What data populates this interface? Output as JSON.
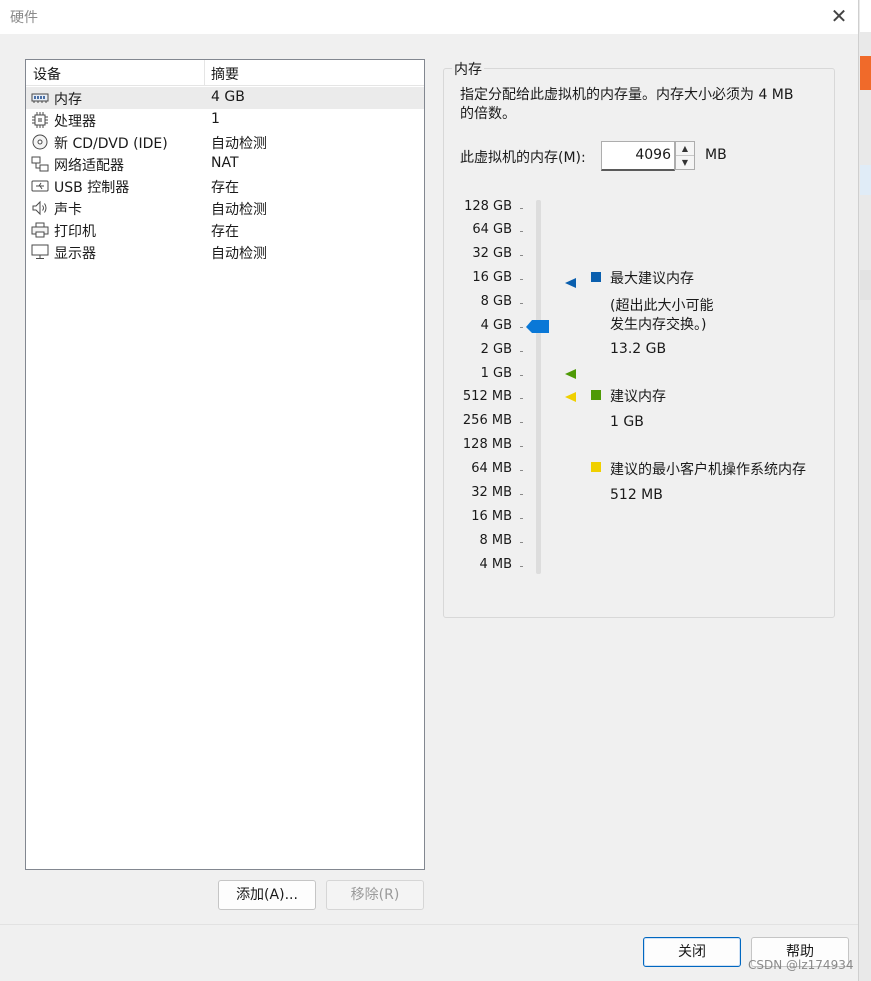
{
  "window": {
    "title": "硬件",
    "close_glyph": "✕"
  },
  "device_list": {
    "columns": [
      "设备",
      "摘要"
    ],
    "rows": [
      {
        "icon": "memory-icon",
        "name": "内存",
        "summary": "4 GB",
        "selected": true
      },
      {
        "icon": "processor-icon",
        "name": "处理器",
        "summary": "1"
      },
      {
        "icon": "cd-dvd-icon",
        "name": "新 CD/DVD (IDE)",
        "summary": "自动检测"
      },
      {
        "icon": "network-adapter-icon",
        "name": "网络适配器",
        "summary": "NAT"
      },
      {
        "icon": "usb-icon",
        "name": "USB 控制器",
        "summary": "存在"
      },
      {
        "icon": "sound-card-icon",
        "name": "声卡",
        "summary": "自动检测"
      },
      {
        "icon": "printer-icon",
        "name": "打印机",
        "summary": "存在"
      },
      {
        "icon": "display-icon",
        "name": "显示器",
        "summary": "自动检测"
      }
    ]
  },
  "buttons": {
    "add": "添加(A)...",
    "remove": "移除(R)",
    "close": "关闭",
    "help": "帮助"
  },
  "memory": {
    "group_title": "内存",
    "description_line1": "指定分配给此虚拟机的内存量。内存大小必须为 4 MB",
    "description_line2": "的倍数。",
    "input_label": "此虚拟机的内存(M):",
    "input_value": "4096",
    "unit": "MB",
    "scale_ticks": [
      "128 GB",
      "64 GB",
      "32 GB",
      "16 GB",
      "8 GB",
      "4 GB",
      "2 GB",
      "1 GB",
      "512 MB",
      "256 MB",
      "128 MB",
      "64 MB",
      "32 MB",
      "16 MB",
      "8 MB",
      "4 MB"
    ],
    "current_value": "4 GB",
    "legend": {
      "max_title": "最大建议内存",
      "max_note_line1": "(超出此大小可能",
      "max_note_line2": "发生内存交换。)",
      "max_value": "13.2 GB",
      "max_color": "#0a5fae",
      "recommended_title": "建议内存",
      "recommended_value": "1 GB",
      "recommended_color": "#4e9a06",
      "min_title": "建议的最小客户机操作系统内存",
      "min_value": "512 MB",
      "min_color": "#f0d000"
    }
  },
  "colors": {
    "slider_thumb": "#0a78d7",
    "selection": "#ebebeb"
  },
  "watermark": "CSDN @lz174934"
}
